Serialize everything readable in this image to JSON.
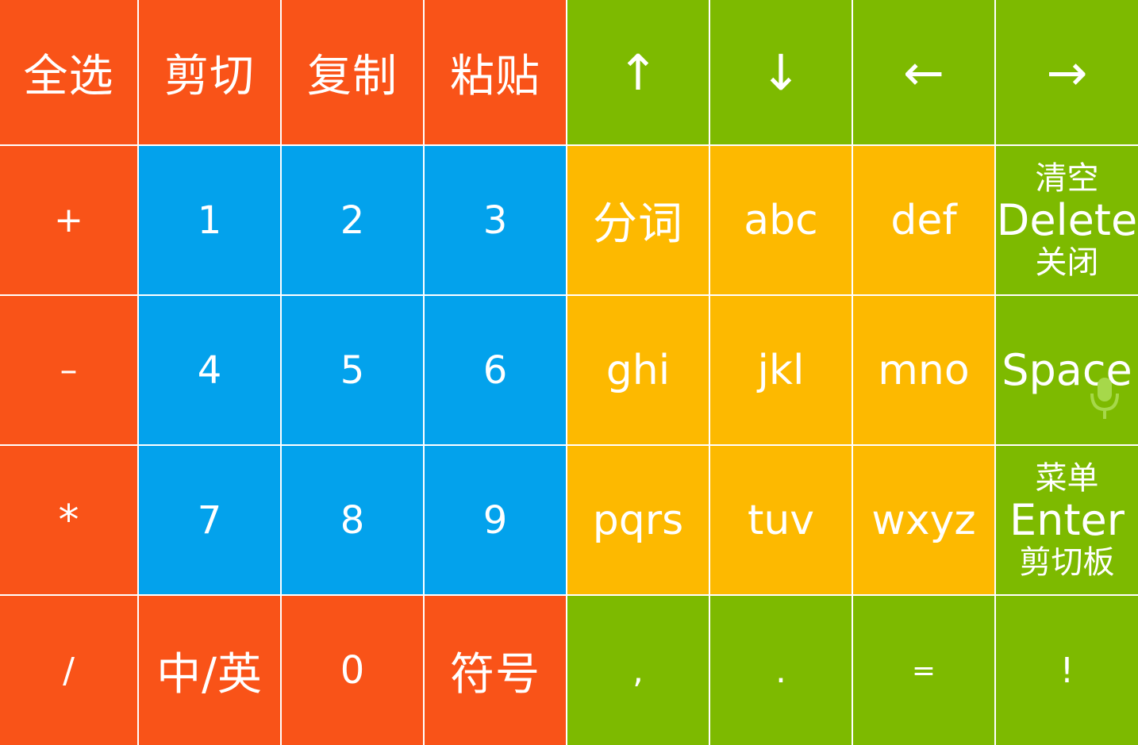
{
  "colors": {
    "orange": "#F95318",
    "blue": "#03A2EC",
    "yellow": "#FDB900",
    "green": "#7DBA00",
    "text": "#FFFFFF",
    "grid": "#FFFFFF"
  },
  "rows": {
    "r1": {
      "select_all": "全选",
      "cut": "剪切",
      "copy": "复制",
      "paste": "粘贴",
      "up": "↑",
      "down": "↓",
      "left": "←",
      "right": "→"
    },
    "r2": {
      "plus": "+",
      "k1": "1",
      "k2": "2",
      "k3": "3",
      "segment": "分词",
      "abc": "abc",
      "def": "def",
      "clear_top": "清空",
      "delete": "Delete",
      "close_bottom": "关闭"
    },
    "r3": {
      "minus": "–",
      "k4": "4",
      "k5": "5",
      "k6": "6",
      "ghi": "ghi",
      "jkl": "jkl",
      "mno": "mno",
      "space": "Space",
      "mic_icon": "microphone-icon"
    },
    "r4": {
      "star": "*",
      "k7": "7",
      "k8": "8",
      "k9": "9",
      "pqrs": "pqrs",
      "tuv": "tuv",
      "wxyz": "wxyz",
      "menu_top": "菜单",
      "enter": "Enter",
      "clipboard_bottom": "剪切板"
    },
    "r5": {
      "slash": "/",
      "lang": "中/英",
      "k0": "0",
      "symbols": "符号",
      "comma": ",",
      "period": ".",
      "equals": "=",
      "exclaim": "!"
    }
  }
}
